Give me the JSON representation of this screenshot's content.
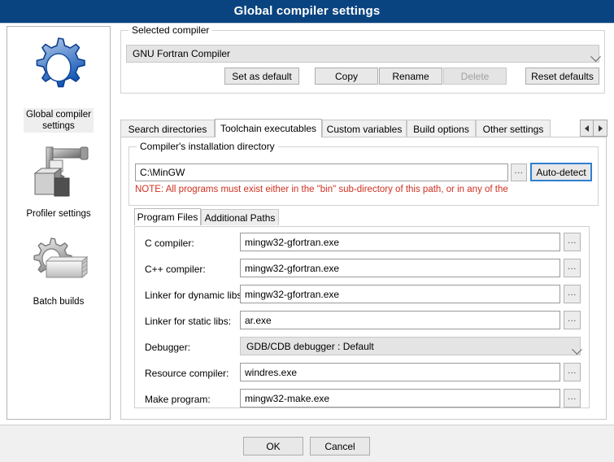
{
  "window": {
    "title": "Global compiler settings",
    "titlebar_color": "#0a4480"
  },
  "sidebar": {
    "items": [
      {
        "label_line1": "Global compiler",
        "label_line2": "settings",
        "icon": "gear-icon",
        "selected": true
      },
      {
        "label_line1": "Profiler settings",
        "label_line2": "",
        "icon": "clamp-icon",
        "selected": false
      },
      {
        "label_line1": "Batch builds",
        "label_line2": "",
        "icon": "gear-stack-icon",
        "selected": false
      }
    ]
  },
  "selected_compiler": {
    "group_title": "Selected compiler",
    "value": "GNU Fortran Compiler",
    "buttons": [
      {
        "label": "Set as default",
        "disabled": false
      },
      {
        "label": "Copy",
        "disabled": false
      },
      {
        "label": "Rename",
        "disabled": false
      },
      {
        "label": "Delete",
        "disabled": true
      },
      {
        "label": "Reset defaults",
        "disabled": false
      }
    ]
  },
  "tabs": {
    "items": [
      {
        "label": "Search directories",
        "active": false
      },
      {
        "label": "Toolchain executables",
        "active": true
      },
      {
        "label": "Custom variables",
        "active": false
      },
      {
        "label": "Build options",
        "active": false
      },
      {
        "label": "Other settings",
        "active": false
      }
    ],
    "nav_prev_icon": "triangle-left-icon",
    "nav_next_icon": "triangle-right-icon"
  },
  "install_dir": {
    "group_title": "Compiler's installation directory",
    "path_value": "C:\\MinGW",
    "browse_label": "...",
    "autodetect_label": "Auto-detect",
    "note": "NOTE: All programs must exist either in the \"bin\" sub-directory of this path, or in any of the",
    "note_color": "#d03020"
  },
  "inner_tabs": {
    "items": [
      {
        "label": "Program Files",
        "active": true
      },
      {
        "label": "Additional Paths",
        "active": false
      }
    ]
  },
  "program_files": {
    "browse_label": "...",
    "rows": [
      {
        "label": "C compiler:",
        "value": "mingw32-gfortran.exe",
        "type": "text"
      },
      {
        "label": "C++ compiler:",
        "value": "mingw32-gfortran.exe",
        "type": "text"
      },
      {
        "label": "Linker for dynamic libs:",
        "value": "mingw32-gfortran.exe",
        "type": "text"
      },
      {
        "label": "Linker for static libs:",
        "value": "ar.exe",
        "type": "text"
      },
      {
        "label": "Debugger:",
        "value": "GDB/CDB debugger : Default",
        "type": "combo"
      },
      {
        "label": "Resource compiler:",
        "value": "windres.exe",
        "type": "text"
      },
      {
        "label": "Make program:",
        "value": "mingw32-make.exe",
        "type": "text"
      }
    ]
  },
  "footer": {
    "ok_label": "OK",
    "cancel_label": "Cancel"
  }
}
